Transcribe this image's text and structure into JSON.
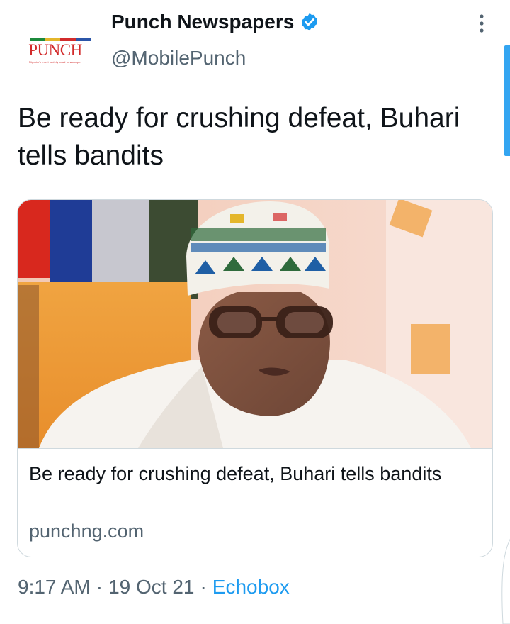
{
  "account": {
    "display_name": "Punch Newspapers",
    "handle": "@MobilePunch",
    "verified": true,
    "avatar_logo_text": "PUNCH",
    "avatar_tagline": "Nigeria's most widely read newspaper"
  },
  "tweet": {
    "text": "Be ready for crushing defeat, Buhari tells bandits"
  },
  "card": {
    "title": "Be ready for crushing defeat, Buhari tells bandits",
    "domain": "punchng.com",
    "image_icon": "news-photo-image"
  },
  "meta": {
    "time": "9:17 AM",
    "separator": "·",
    "date": "19 Oct 21",
    "source": "Echobox"
  },
  "colors": {
    "accent": "#1d9bf0",
    "text": "#0f1419",
    "secondary": "#536471",
    "border": "#cfd9de",
    "logo_red": "#d22b2b"
  }
}
